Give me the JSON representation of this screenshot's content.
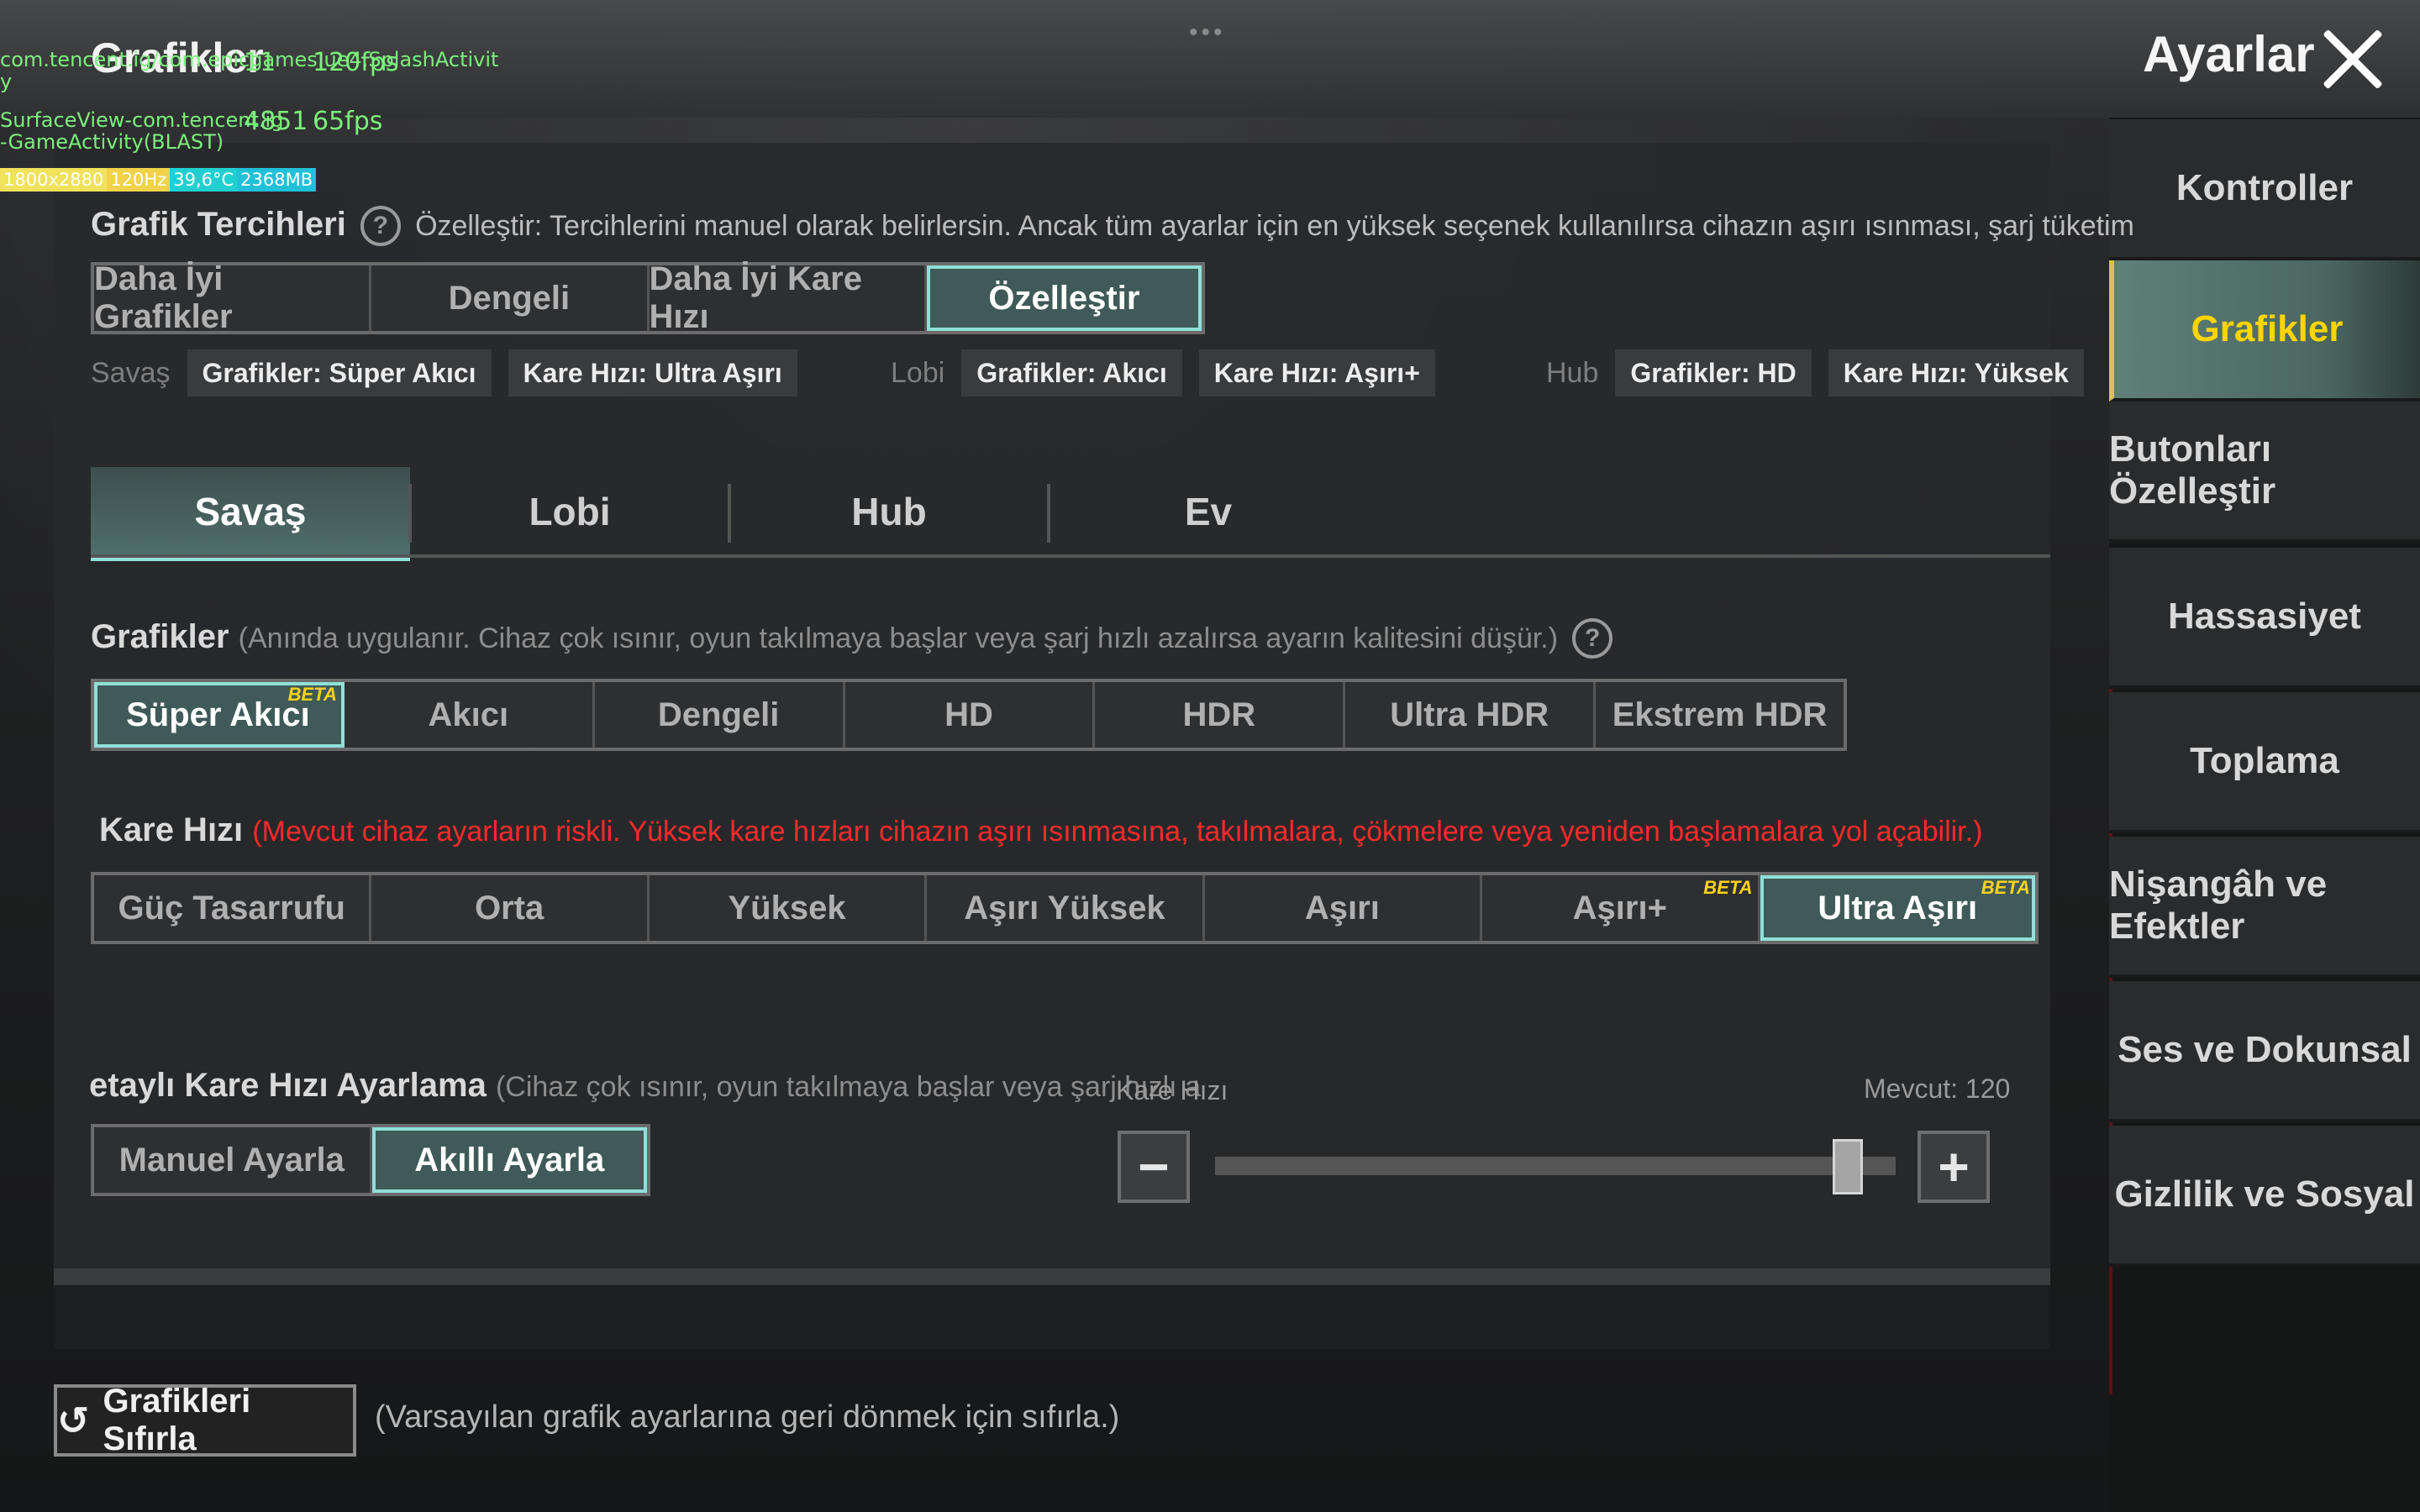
{
  "header": {
    "title_left": "Grafikler",
    "title_right": "Ayarlar",
    "dots": "•••"
  },
  "debug": {
    "line1": "com.tencent.ig/com.epicgames.ue4.SplashActivit",
    "line1_tail": "y",
    "line1_num": "11",
    "line1_fps": "120fps",
    "line2": "SurfaceView-com.tencent.ig",
    "line2_tail": "-GameActivity(BLAST)",
    "line2_num": "4851",
    "line2_fps": "65fps",
    "badges": [
      "1800x2880",
      "120Hz",
      "39,6°C",
      "2368MB"
    ],
    "badge_colors": [
      "#f0e25a",
      "#f0d34a",
      "#20d0d0",
      "#20c0d8"
    ]
  },
  "sidebar": {
    "items": [
      {
        "label": "Kontroller",
        "active": false
      },
      {
        "label": "Grafikler",
        "active": true
      },
      {
        "label": "Butonları Özelleştir",
        "active": false
      },
      {
        "label": "Hassasiyet",
        "active": false
      },
      {
        "label": "Toplama",
        "active": false
      },
      {
        "label": "Nişangâh ve Efektler",
        "active": false
      },
      {
        "label": "Ses ve Dokunsal",
        "active": false
      },
      {
        "label": "Gizlilik ve Sosyal",
        "active": false
      }
    ]
  },
  "prefs": {
    "title": "Grafik Tercihleri",
    "note": "Özelleştir: Tercihlerini manuel olarak belirlersin. Ancak tüm ayarlar için en yüksek seçenek kullanılırsa cihazın aşırı ısınması, şarj tüketim",
    "options": [
      "Daha İyi Grafikler",
      "Dengeli",
      "Daha İyi Kare Hızı",
      "Özelleştir"
    ],
    "selected": "Özelleştir"
  },
  "summary": {
    "savas_label": "Savaş",
    "savas_chips": [
      "Grafikler: Süper Akıcı",
      "Kare Hızı: Ultra Aşırı"
    ],
    "lobi_label": "Lobi",
    "lobi_chips": [
      "Grafikler: Akıcı",
      "Kare Hızı: Aşırı+"
    ],
    "hub_label": "Hub",
    "hub_chips": [
      "Grafikler: HD",
      "Kare Hızı: Yüksek"
    ]
  },
  "tabs": {
    "items": [
      "Savaş",
      "Lobi",
      "Hub",
      "Ev"
    ],
    "selected": "Savaş"
  },
  "graphics": {
    "title": "Grafikler",
    "note": "(Anında uygulanır. Cihaz çok ısınır, oyun takılmaya başlar veya şarj hızlı azalırsa ayarın kalitesini düşür.)",
    "options": [
      "Süper Akıcı",
      "Akıcı",
      "Dengeli",
      "HD",
      "HDR",
      "Ultra HDR",
      "Ekstrem HDR"
    ],
    "selected": "Süper Akıcı",
    "beta_label": "BETA"
  },
  "framerate": {
    "title": "Kare Hızı",
    "warning": "(Mevcut cihaz ayarların riskli. Yüksek kare hızları cihazın aşırı ısınmasına, takılmalara, çökmelere veya yeniden başlamalara yol açabilir.)",
    "options": [
      "Güç Tasarrufu",
      "Orta",
      "Yüksek",
      "Aşırı Yüksek",
      "Aşırı",
      "Aşırı+",
      "Ultra Aşırı"
    ],
    "selected": "Ultra Aşırı",
    "beta_label": "BETA"
  },
  "detailed": {
    "title": "etaylı Kare Hızı Ayarlama",
    "note": "(Cihaz çok ısınır, oyun takılmaya başlar veya şarj hızlı a",
    "options": [
      "Manuel Ayarla",
      "Akıllı Ayarla"
    ],
    "selected": "Akıllı Ayarla",
    "slider_label": "Kare Hızı",
    "current_label": "Mevcut: 120",
    "slider_level": 0.93,
    "minus": "−",
    "plus": "+"
  },
  "reset": {
    "button_label": "Grafikleri Sıfırla",
    "icon": "↺",
    "note": "(Varsayılan grafik ayarlarına geri dönmek için sıfırla.)"
  },
  "colors": {
    "accent": "#8fe0d8",
    "active_sidebar_text": "#ffd500",
    "warning_red": "#ff2a2a",
    "beta_yellow": "#ffd21a"
  }
}
